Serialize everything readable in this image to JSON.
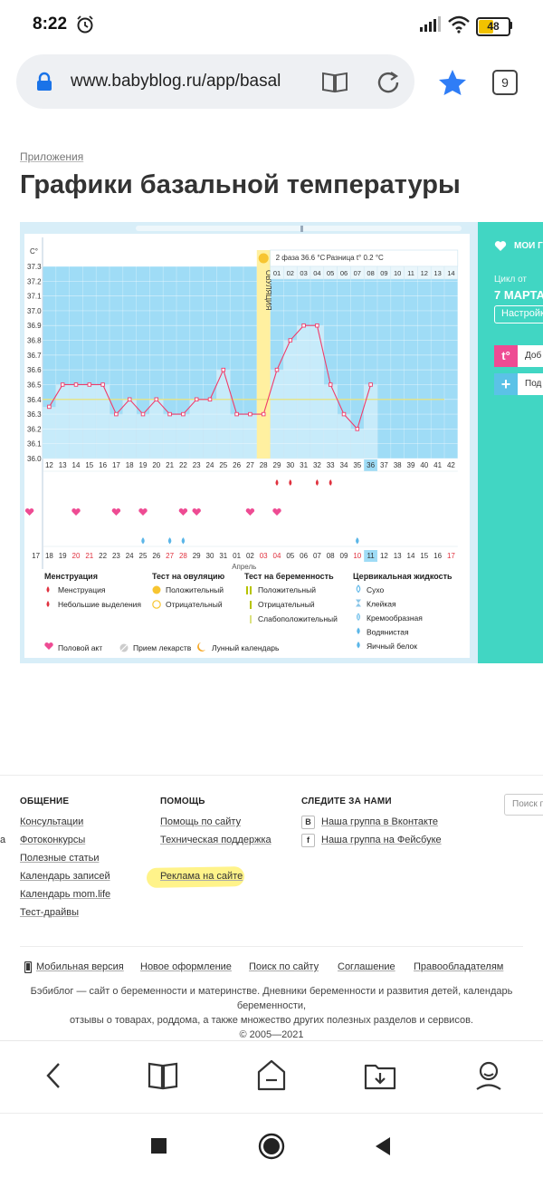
{
  "status": {
    "time": "8:22",
    "battery": "48"
  },
  "browser": {
    "url": "www.babyblog.ru/app/basal",
    "tab_count": "9"
  },
  "page": {
    "breadcrumb": "Приложения",
    "title": "Графики базальной температуры"
  },
  "chart_header": {
    "ovulation_label": "ОВУЛЯЦИЯ",
    "phase2": "2 фаза 36.6 °С",
    "diff": "Разница t° 0.2 °С"
  },
  "chart_data": {
    "type": "line",
    "y_unit": "С°",
    "ylim": [
      36.0,
      37.3
    ],
    "y_ticks": [
      "37.3",
      "37.2",
      "37.1",
      "37.0",
      "36.9",
      "36.8",
      "36.7",
      "36.6",
      "36.5",
      "36.4",
      "36.3",
      "36.2",
      "36.1",
      "36.0"
    ],
    "day_labels": [
      "12",
      "13",
      "14",
      "15",
      "16",
      "17",
      "18",
      "19",
      "20",
      "21",
      "22",
      "23",
      "24",
      "25",
      "26",
      "27",
      "28",
      "29",
      "30",
      "31",
      "32",
      "33",
      "34",
      "35",
      "36",
      "37",
      "38",
      "39",
      "40",
      "41",
      "42"
    ],
    "temperatures": [
      36.35,
      36.5,
      36.5,
      36.5,
      36.5,
      36.3,
      36.4,
      36.3,
      36.4,
      36.3,
      36.3,
      36.4,
      36.4,
      36.6,
      36.3,
      36.3,
      36.3,
      36.6,
      36.8,
      36.9,
      36.9,
      36.5,
      36.3,
      36.2,
      36.5
    ],
    "coverline": 36.4,
    "ovulation_day": "28",
    "phase2_days": [
      "01",
      "02",
      "03",
      "04",
      "05",
      "06",
      "07",
      "08",
      "09",
      "10",
      "11",
      "12",
      "13",
      "14"
    ],
    "date_labels": [
      "17",
      "18",
      "19",
      "20",
      "21",
      "22",
      "23",
      "24",
      "25",
      "26",
      "27",
      "28",
      "29",
      "30",
      "31",
      "01",
      "02",
      "03",
      "04",
      "05",
      "06",
      "07",
      "08",
      "09",
      "10",
      "11",
      "12",
      "13",
      "14",
      "15",
      "16",
      "17"
    ],
    "month_label": "Апрель",
    "current_day": "36",
    "current_date": "11"
  },
  "legend": {
    "menstruation": {
      "title": "Менструация",
      "items": [
        "Менструация",
        "Небольшие выделения"
      ]
    },
    "ovulation_test": {
      "title": "Тест на овуляцию",
      "items": [
        "Положительный",
        "Отрицательный"
      ]
    },
    "pregnancy_test": {
      "title": "Тест на беременность",
      "items": [
        "Положительный",
        "Отрицательный",
        "Слабоположительный"
      ]
    },
    "cervical": {
      "title": "Цервикальная жидкость",
      "items": [
        "Сухо",
        "Клейкая",
        "Кремообразная",
        "Водянистая",
        "Яичный белок"
      ]
    },
    "other": [
      "Половой акт",
      "Прием лекарств",
      "Лунный календарь"
    ]
  },
  "side_panel": {
    "title": "МОИ ГР",
    "cycle_label": "Цикл от",
    "cycle_date": "7 МАРТА",
    "settings_button": "Настройк",
    "add_temp": "Доб",
    "add_other": "Под"
  },
  "footer": {
    "col1": {
      "title": "ОБЩЕНИЕ",
      "links": [
        "Консультации",
        "Фотоконкурсы",
        "Полезные статьи",
        "Календарь записей",
        "Календарь mom.life",
        "Тест-драйвы"
      ]
    },
    "col2": {
      "title": "ПОМОЩЬ",
      "links": [
        "Помощь по сайту",
        "Техническая поддержка",
        "Реклама на сайте"
      ]
    },
    "col3": {
      "title": "СЛЕДИТЕ ЗА НАМИ",
      "links": [
        "Наша группа в Вконтакте",
        "Наша группа на Фейсбуке"
      ]
    },
    "search_placeholder": "Поиск п",
    "left_clip": "а",
    "bottom_links": [
      "Мобильная версия",
      "Новое оформление",
      "Поиск по сайту",
      "Соглашение",
      "Правообладателям"
    ],
    "description_1": "Бэбиблог — сайт о беременности и материнстве. Дневники беременности и развития детей, календарь беременности,",
    "description_2": "отзывы о товарах, роддома, а также множество других полезных разделов и сервисов.",
    "copyright": "© 2005—2021"
  },
  "colors": {
    "accent": "#41d6c3",
    "chart_bg": "#9fdcf6",
    "bar": "#c7ebfa",
    "line": "#f03c6a",
    "ovulation": "#fff0a0",
    "highlight": "#fff38a"
  }
}
